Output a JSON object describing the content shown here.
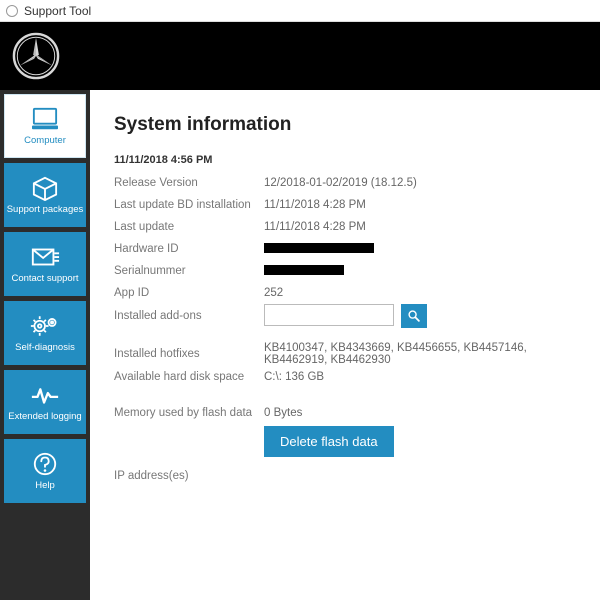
{
  "window": {
    "title": "Support Tool"
  },
  "sidebar": {
    "items": [
      {
        "label": "Computer"
      },
      {
        "label": "Support packages"
      },
      {
        "label": "Contact support"
      },
      {
        "label": "Self-diagnosis"
      },
      {
        "label": "Extended logging"
      },
      {
        "label": "Help"
      }
    ]
  },
  "page": {
    "title": "System information",
    "timestamp": "11/11/2018 4:56 PM",
    "rows": {
      "release_version": {
        "label": "Release Version",
        "value": "12/2018-01-02/2019 (18.12.5)"
      },
      "last_update_bd": {
        "label": "Last update BD installation",
        "value": "11/11/2018 4:28 PM"
      },
      "last_update": {
        "label": "Last update",
        "value": "11/11/2018 4:28 PM"
      },
      "hardware_id": {
        "label": "Hardware ID",
        "value": ""
      },
      "serialnummer": {
        "label": "Serialnummer",
        "value": ""
      },
      "app_id": {
        "label": "App ID",
        "value": "252"
      },
      "addons": {
        "label": "Installed add-ons",
        "placeholder": ""
      },
      "hotfixes": {
        "label": "Installed hotfixes",
        "value": "KB4100347, KB4343669, KB4456655, KB4457146, KB4462919, KB4462930"
      },
      "disk": {
        "label": "Available hard disk space",
        "value": "C:\\: 136 GB"
      },
      "flash_mem": {
        "label": "Memory used by flash data",
        "value": "0 Bytes"
      },
      "ip": {
        "label": "IP address(es)",
        "value": ""
      }
    },
    "buttons": {
      "delete_flash": "Delete flash data"
    }
  }
}
